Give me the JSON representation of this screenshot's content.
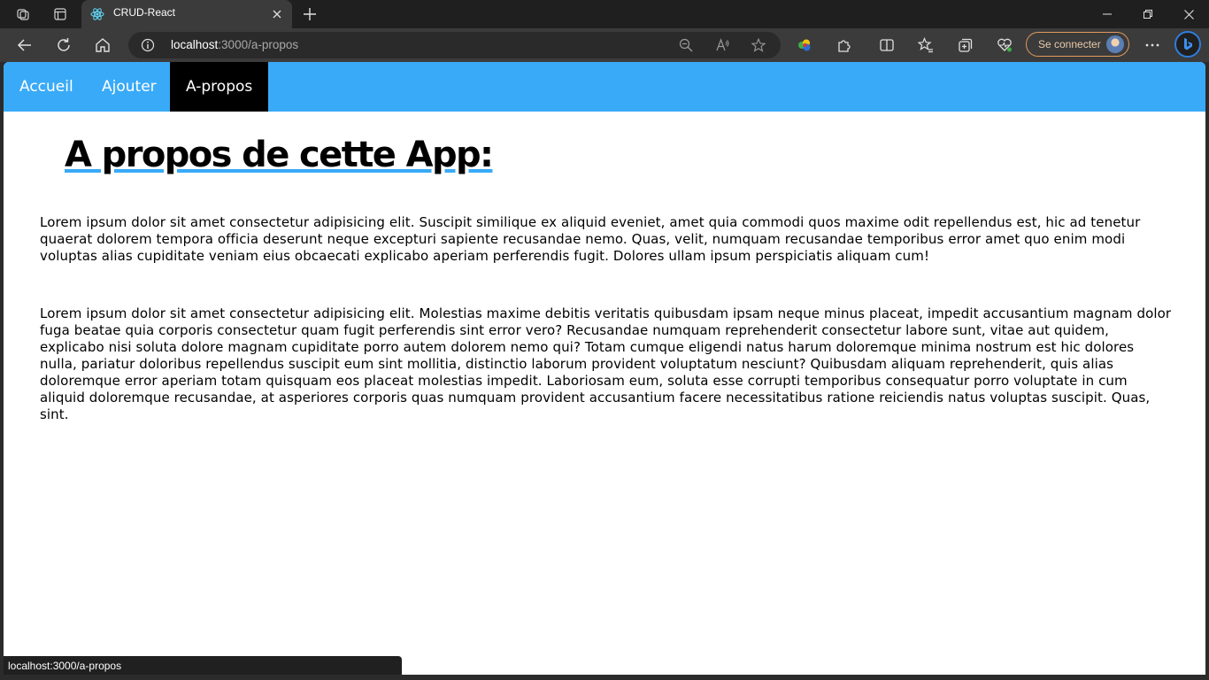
{
  "browser": {
    "tab": {
      "title": "CRUD-React",
      "favicon": "react-logo-icon"
    },
    "address": {
      "host": "localhost",
      "rest": ":3000/a-propos"
    },
    "signin_label": "Se connecter",
    "status_url": "localhost:3000/a-propos",
    "colors": {
      "frame": "#1f1f1f",
      "toolbar": "#3b3b3b",
      "signin_border": "#e49a5d"
    }
  },
  "app": {
    "nav": [
      {
        "label": "Accueil",
        "active": false
      },
      {
        "label": "Ajouter",
        "active": false
      },
      {
        "label": "A-propos",
        "active": true
      }
    ],
    "title": "A propos de cette App:",
    "paragraphs": [
      "Lorem ipsum dolor sit amet consectetur adipisicing elit. Suscipit similique ex aliquid eveniet, amet quia commodi quos maxime odit repellendus est, hic ad tenetur quaerat dolorem tempora officia deserunt neque excepturi sapiente recusandae nemo. Quas, velit, numquam recusandae temporibus error amet quo enim modi voluptas alias cupiditate veniam eius obcaecati explicabo aperiam perferendis fugit. Dolores ullam ipsum perspiciatis aliquam cum!",
      "Lorem ipsum dolor sit amet consectetur adipisicing elit. Molestias maxime debitis veritatis quibusdam ipsam neque minus placeat, impedit accusantium magnam dolor fuga beatae quia corporis consectetur quam fugit perferendis sint error vero? Recusandae numquam reprehenderit consectetur labore sunt, vitae aut quidem, explicabo nisi soluta dolore magnam cupiditate porro autem dolorem nemo qui? Totam cumque eligendi natus harum doloremque minima nostrum est hic dolores nulla, pariatur doloribus repellendus suscipit eum sint mollitia, distinctio laborum provident voluptatum nesciunt? Quibusdam aliquam reprehenderit, quis alias doloremque error aperiam totam quisquam eos placeat molestias impedit. Laboriosam eum, soluta esse corrupti temporibus consequatur porro voluptate in cum aliquid doloremque recusandae, at asperiores corporis quas numquam provident accusantium facere necessitatibus ratione reiciendis natus voluptas suscipit. Quas, sint."
    ],
    "colors": {
      "nav_bg": "#39aaf7",
      "nav_active": "#000000",
      "title_underline": "#39aaf7"
    }
  }
}
